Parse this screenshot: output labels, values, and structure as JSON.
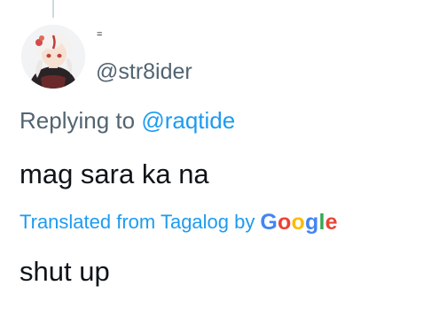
{
  "tweet": {
    "name_mark": "=",
    "handle": "@str8ider",
    "replying_prefix": "Replying to",
    "replying_mention": "@raqtide",
    "text": "mag sara ka na",
    "translation_label": "Translated from Tagalog by",
    "translation_provider": "Google",
    "translated_text": "shut up"
  },
  "colors": {
    "text_primary": "#0f1419",
    "text_secondary": "#536471",
    "link": "#1d9bf0",
    "thread_line": "#cfd9de",
    "google": [
      "#4285F4",
      "#EA4335",
      "#FBBC05",
      "#4285F4",
      "#34A853",
      "#EA4335"
    ]
  },
  "icons": {
    "avatar": "avatar-image"
  }
}
